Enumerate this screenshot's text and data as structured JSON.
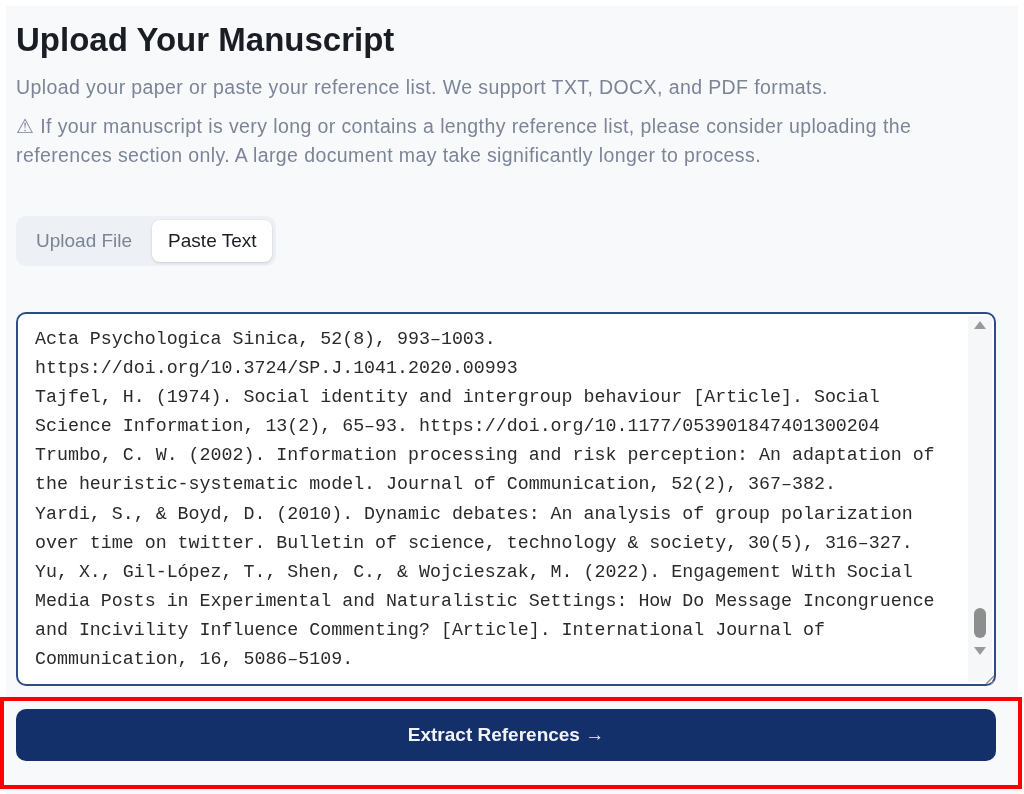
{
  "heading": "Upload Your Manuscript",
  "intro": "Upload your paper or paste your reference list. We support TXT, DOCX, and PDF formats.",
  "warning": {
    "icon": "⚠",
    "text": "If your manuscript is very long or contains a lengthy reference list, please consider uploading the references section only. A large document may take significantly longer to process."
  },
  "tabs": [
    {
      "label": "Upload File",
      "selected": false
    },
    {
      "label": "Paste Text",
      "selected": true
    }
  ],
  "text_input": {
    "lines": [
      "Acta Psychologica Sinica, 52(8), 993–1003.",
      "https://doi.org/10.3724/SP.J.1041.2020.00993",
      "Tajfel, H. (1974). Social identity and intergroup behaviour [Article]. Social",
      "Science Information, 13(2), 65–93. https://doi.org/10.1177/053901847401300204",
      "Trumbo, C. W. (2002). Information processing and risk perception: An adaptation of",
      "the heuristic-systematic model. Journal of Communication, 52(2), 367–382.",
      "Yardi, S., & Boyd, D. (2010). Dynamic debates: An analysis of group polarization",
      "over time on twitter. Bulletin of science, technology & society, 30(5), 316–327.",
      "Yu, X., Gil-López, T., Shen, C., & Wojcieszak, M. (2022). Engagement With Social",
      "Media Posts in Experimental and Naturalistic Settings: How Do Message Incongruence",
      "and Incivility Influence Commenting? [Article]. International Journal of",
      "Communication, 16, 5086–5109. "
    ]
  },
  "submit_button": "Extract References →"
}
